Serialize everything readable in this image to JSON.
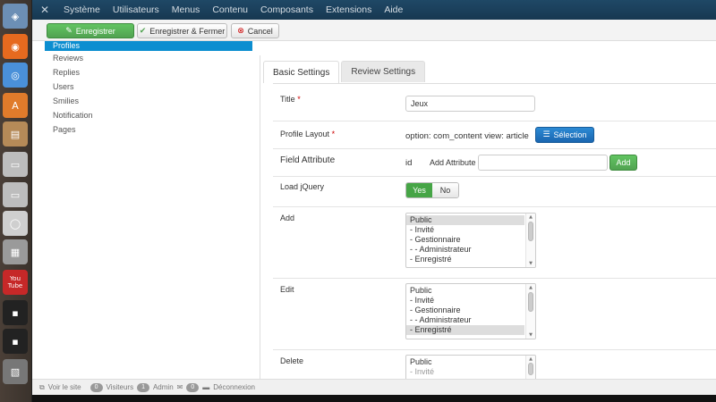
{
  "launcher": {
    "items": [
      {
        "icon": "ubuntu-dash-icon",
        "glyph": "◈",
        "color": "#6c8fb5"
      },
      {
        "icon": "firefox-icon",
        "glyph": "◉",
        "color": "#e66a1f"
      },
      {
        "icon": "chromium-icon",
        "glyph": "◎",
        "color": "#4a90d9"
      },
      {
        "icon": "software-center-icon",
        "glyph": "A",
        "color": "#e07b2b"
      },
      {
        "icon": "file-manager-icon",
        "glyph": "▤",
        "color": "#b58a58"
      },
      {
        "icon": "drive-icon",
        "glyph": "▭",
        "color": "#bdbdbd"
      },
      {
        "icon": "drive-2-icon",
        "glyph": "▭",
        "color": "#bdbdbd"
      },
      {
        "icon": "disc-icon",
        "glyph": "◯",
        "color": "#cfcfcf"
      },
      {
        "icon": "calculator-icon",
        "glyph": "▦",
        "color": "#9a9a9a"
      },
      {
        "icon": "youtube-icon",
        "glyph": "You Tube",
        "color": "#c62828"
      },
      {
        "icon": "workspace-switcher-icon",
        "glyph": "▪",
        "color": "#222"
      },
      {
        "icon": "workspace-switcher-2-icon",
        "glyph": "▪",
        "color": "#222"
      },
      {
        "icon": "trash-icon",
        "glyph": "▧",
        "color": "#777"
      }
    ]
  },
  "topnav": {
    "logo_icon": "joomla-icon",
    "items": [
      "Système",
      "Utilisateurs",
      "Menus",
      "Contenu",
      "Composants",
      "Extensions",
      "Aide"
    ]
  },
  "toolbar": {
    "save_label": "Enregistrer",
    "save_close_label": "Enregistrer & Fermer",
    "cancel_label": "Cancel"
  },
  "sidebar": {
    "items": [
      "Profiles",
      "Reviews",
      "Replies",
      "Users",
      "Smilies",
      "Notification",
      "Pages"
    ],
    "active_index": 0
  },
  "tabs": [
    "Basic Settings",
    "Review Settings"
  ],
  "form": {
    "title_label": "Title",
    "title_value": "Jeux",
    "profile_layout_label": "Profile Layout",
    "profile_layout_value": "option: com_content view: article",
    "selection_button": "Sélection",
    "field_attribute_label": "Field Attribute",
    "field_attribute_id": "id",
    "add_attribute_label": "Add Attribute",
    "add_attribute_value": "",
    "add_button": "Add",
    "load_jquery_label": "Load jQuery",
    "yes_label": "Yes",
    "no_label": "No",
    "load_jquery_value": "Yes",
    "add_label": "Add",
    "add_options": [
      "Public",
      "- Invité",
      "- Gestionnaire",
      "- - Administrateur",
      "- Enregistré"
    ],
    "add_selected": "Public",
    "edit_label": "Edit",
    "edit_options": [
      "Public",
      "- Invité",
      "- Gestionnaire",
      "- - Administrateur",
      "- Enregistré"
    ],
    "edit_selected": "- Enregistré",
    "delete_label": "Delete",
    "delete_options": [
      "Public",
      "- Invité"
    ]
  },
  "statusbar": {
    "view_site": "Voir le site",
    "visitors_count": "0",
    "visitors_label": "Visiteurs",
    "admin_count": "1",
    "admin_label": "Admin",
    "messages_count": "0",
    "logout_label": "Déconnexion"
  }
}
